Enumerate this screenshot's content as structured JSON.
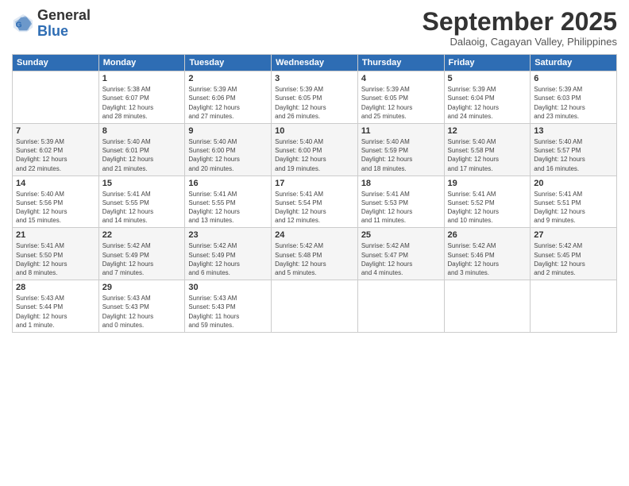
{
  "header": {
    "logo_general": "General",
    "logo_blue": "Blue",
    "month_title": "September 2025",
    "subtitle": "Dalaoig, Cagayan Valley, Philippines"
  },
  "weekdays": [
    "Sunday",
    "Monday",
    "Tuesday",
    "Wednesday",
    "Thursday",
    "Friday",
    "Saturday"
  ],
  "weeks": [
    [
      {
        "day": "",
        "info": ""
      },
      {
        "day": "1",
        "info": "Sunrise: 5:38 AM\nSunset: 6:07 PM\nDaylight: 12 hours\nand 28 minutes."
      },
      {
        "day": "2",
        "info": "Sunrise: 5:39 AM\nSunset: 6:06 PM\nDaylight: 12 hours\nand 27 minutes."
      },
      {
        "day": "3",
        "info": "Sunrise: 5:39 AM\nSunset: 6:05 PM\nDaylight: 12 hours\nand 26 minutes."
      },
      {
        "day": "4",
        "info": "Sunrise: 5:39 AM\nSunset: 6:05 PM\nDaylight: 12 hours\nand 25 minutes."
      },
      {
        "day": "5",
        "info": "Sunrise: 5:39 AM\nSunset: 6:04 PM\nDaylight: 12 hours\nand 24 minutes."
      },
      {
        "day": "6",
        "info": "Sunrise: 5:39 AM\nSunset: 6:03 PM\nDaylight: 12 hours\nand 23 minutes."
      }
    ],
    [
      {
        "day": "7",
        "info": "Sunrise: 5:39 AM\nSunset: 6:02 PM\nDaylight: 12 hours\nand 22 minutes."
      },
      {
        "day": "8",
        "info": "Sunrise: 5:40 AM\nSunset: 6:01 PM\nDaylight: 12 hours\nand 21 minutes."
      },
      {
        "day": "9",
        "info": "Sunrise: 5:40 AM\nSunset: 6:00 PM\nDaylight: 12 hours\nand 20 minutes."
      },
      {
        "day": "10",
        "info": "Sunrise: 5:40 AM\nSunset: 6:00 PM\nDaylight: 12 hours\nand 19 minutes."
      },
      {
        "day": "11",
        "info": "Sunrise: 5:40 AM\nSunset: 5:59 PM\nDaylight: 12 hours\nand 18 minutes."
      },
      {
        "day": "12",
        "info": "Sunrise: 5:40 AM\nSunset: 5:58 PM\nDaylight: 12 hours\nand 17 minutes."
      },
      {
        "day": "13",
        "info": "Sunrise: 5:40 AM\nSunset: 5:57 PM\nDaylight: 12 hours\nand 16 minutes."
      }
    ],
    [
      {
        "day": "14",
        "info": "Sunrise: 5:40 AM\nSunset: 5:56 PM\nDaylight: 12 hours\nand 15 minutes."
      },
      {
        "day": "15",
        "info": "Sunrise: 5:41 AM\nSunset: 5:55 PM\nDaylight: 12 hours\nand 14 minutes."
      },
      {
        "day": "16",
        "info": "Sunrise: 5:41 AM\nSunset: 5:55 PM\nDaylight: 12 hours\nand 13 minutes."
      },
      {
        "day": "17",
        "info": "Sunrise: 5:41 AM\nSunset: 5:54 PM\nDaylight: 12 hours\nand 12 minutes."
      },
      {
        "day": "18",
        "info": "Sunrise: 5:41 AM\nSunset: 5:53 PM\nDaylight: 12 hours\nand 11 minutes."
      },
      {
        "day": "19",
        "info": "Sunrise: 5:41 AM\nSunset: 5:52 PM\nDaylight: 12 hours\nand 10 minutes."
      },
      {
        "day": "20",
        "info": "Sunrise: 5:41 AM\nSunset: 5:51 PM\nDaylight: 12 hours\nand 9 minutes."
      }
    ],
    [
      {
        "day": "21",
        "info": "Sunrise: 5:41 AM\nSunset: 5:50 PM\nDaylight: 12 hours\nand 8 minutes."
      },
      {
        "day": "22",
        "info": "Sunrise: 5:42 AM\nSunset: 5:49 PM\nDaylight: 12 hours\nand 7 minutes."
      },
      {
        "day": "23",
        "info": "Sunrise: 5:42 AM\nSunset: 5:49 PM\nDaylight: 12 hours\nand 6 minutes."
      },
      {
        "day": "24",
        "info": "Sunrise: 5:42 AM\nSunset: 5:48 PM\nDaylight: 12 hours\nand 5 minutes."
      },
      {
        "day": "25",
        "info": "Sunrise: 5:42 AM\nSunset: 5:47 PM\nDaylight: 12 hours\nand 4 minutes."
      },
      {
        "day": "26",
        "info": "Sunrise: 5:42 AM\nSunset: 5:46 PM\nDaylight: 12 hours\nand 3 minutes."
      },
      {
        "day": "27",
        "info": "Sunrise: 5:42 AM\nSunset: 5:45 PM\nDaylight: 12 hours\nand 2 minutes."
      }
    ],
    [
      {
        "day": "28",
        "info": "Sunrise: 5:43 AM\nSunset: 5:44 PM\nDaylight: 12 hours\nand 1 minute."
      },
      {
        "day": "29",
        "info": "Sunrise: 5:43 AM\nSunset: 5:43 PM\nDaylight: 12 hours\nand 0 minutes."
      },
      {
        "day": "30",
        "info": "Sunrise: 5:43 AM\nSunset: 5:43 PM\nDaylight: 11 hours\nand 59 minutes."
      },
      {
        "day": "",
        "info": ""
      },
      {
        "day": "",
        "info": ""
      },
      {
        "day": "",
        "info": ""
      },
      {
        "day": "",
        "info": ""
      }
    ]
  ]
}
